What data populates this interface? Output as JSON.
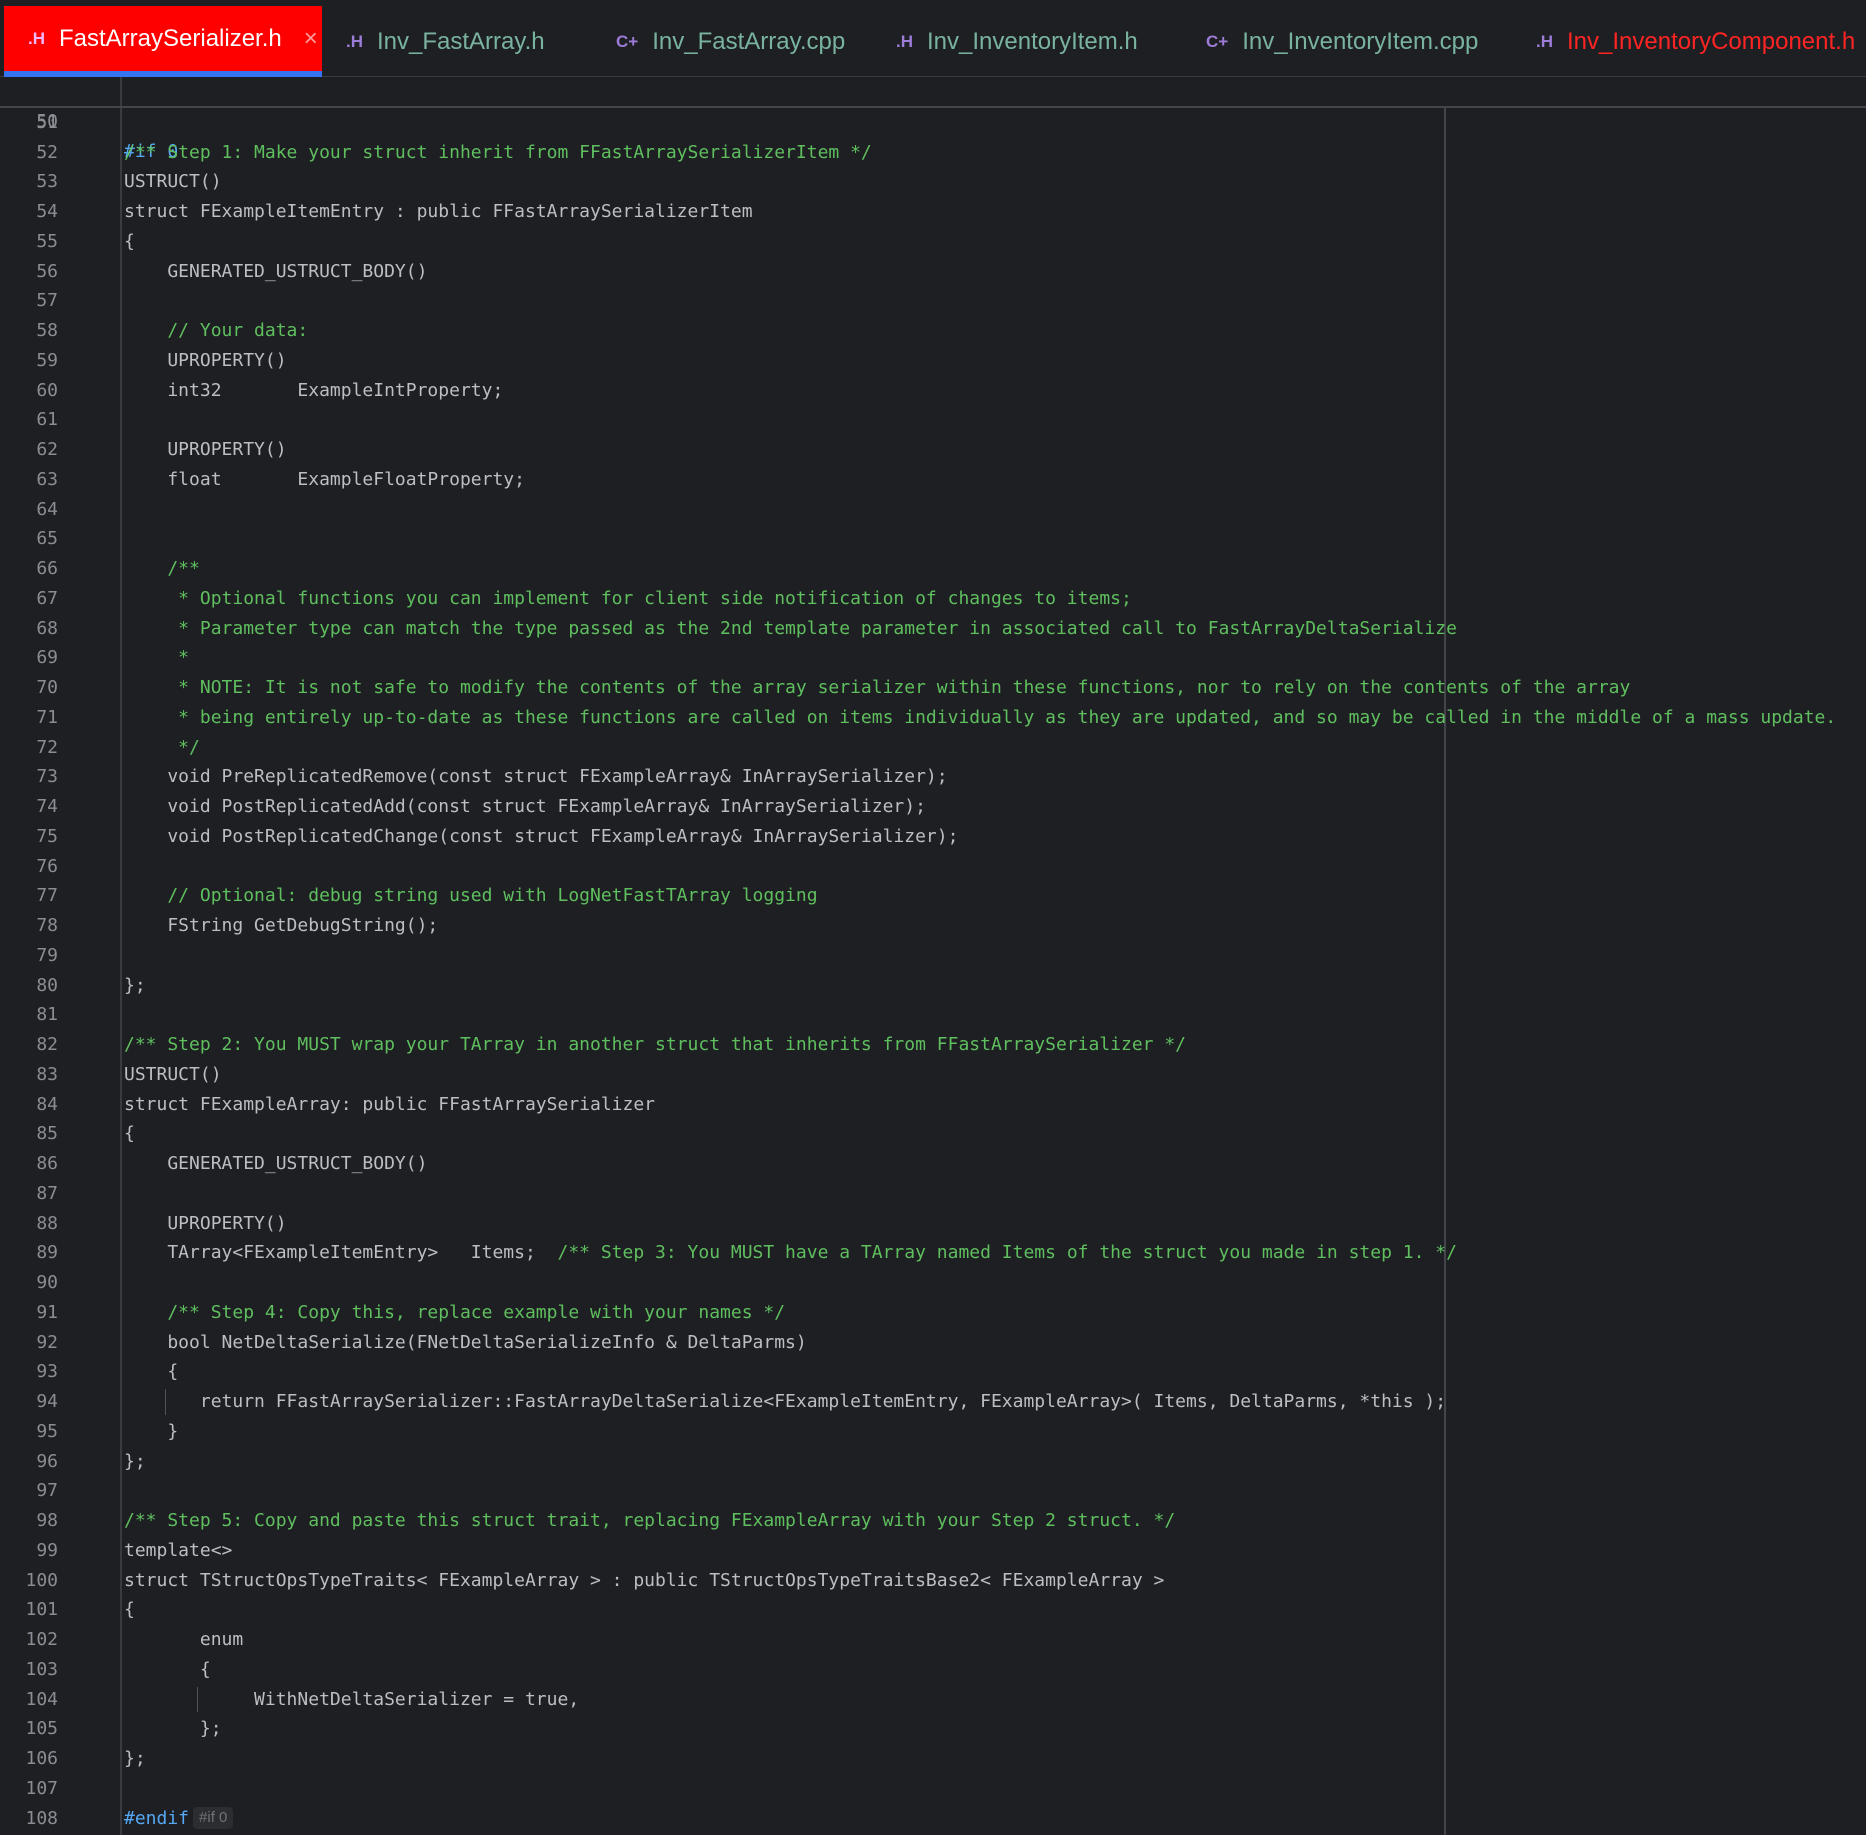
{
  "tabs": [
    {
      "label": "FastArraySerializer.h",
      "icon": "header-file-icon",
      "active": true
    },
    {
      "label": "Inv_FastArray.h",
      "icon": "header-file-icon"
    },
    {
      "label": "Inv_FastArray.cpp",
      "icon": "cpp-file-icon"
    },
    {
      "label": "Inv_InventoryItem.h",
      "icon": "header-file-icon"
    },
    {
      "label": "Inv_InventoryItem.cpp",
      "icon": "cpp-file-icon"
    },
    {
      "label": "Inv_InventoryComponent.h",
      "icon": "header-file-icon"
    }
  ],
  "tab_icons": {
    "header": ".H",
    "cpp": "C+",
    "close": "×"
  },
  "colors": {
    "active_tab": "#fe0000",
    "tab_text": "#79b3a0",
    "modified_tab_text": "#ff2424",
    "comment": "#5fbf5f",
    "preprocessor": "#56a8f5",
    "code_text": "#bcbec4",
    "background": "#1e1f22"
  },
  "editor": {
    "sticky_line": {
      "num": "50",
      "text": "#if 0"
    },
    "lines": [
      {
        "num": "51",
        "text": ""
      },
      {
        "num": "52",
        "text": "/** Step 1: Make your struct inherit from FFastArraySerializerItem */",
        "kind": "comment"
      },
      {
        "num": "53",
        "text": "USTRUCT()"
      },
      {
        "num": "54",
        "text": "struct FExampleItemEntry : public FFastArraySerializerItem"
      },
      {
        "num": "55",
        "text": "{"
      },
      {
        "num": "56",
        "text": "    GENERATED_USTRUCT_BODY()"
      },
      {
        "num": "57",
        "text": ""
      },
      {
        "num": "58",
        "text": "    // Your data:",
        "kind": "comment"
      },
      {
        "num": "59",
        "text": "    UPROPERTY()"
      },
      {
        "num": "60",
        "text": "    int32       ExampleIntProperty;"
      },
      {
        "num": "61",
        "text": ""
      },
      {
        "num": "62",
        "text": "    UPROPERTY()"
      },
      {
        "num": "63",
        "text": "    float       ExampleFloatProperty;"
      },
      {
        "num": "64",
        "text": ""
      },
      {
        "num": "65",
        "text": ""
      },
      {
        "num": "66",
        "text": "    /**",
        "kind": "comment"
      },
      {
        "num": "67",
        "text": "     * Optional functions you can implement for client side notification of changes to items;",
        "kind": "comment"
      },
      {
        "num": "68",
        "text": "     * Parameter type can match the type passed as the 2nd template parameter in associated call to FastArrayDeltaSerialize",
        "kind": "comment"
      },
      {
        "num": "69",
        "text": "     *",
        "kind": "comment"
      },
      {
        "num": "70",
        "text": "     * NOTE: It is not safe to modify the contents of the array serializer within these functions, nor to rely on the contents of the array",
        "kind": "comment"
      },
      {
        "num": "71",
        "text": "     * being entirely up-to-date as these functions are called on items individually as they are updated, and so may be called in the middle of a mass update.",
        "kind": "comment"
      },
      {
        "num": "72",
        "text": "     */",
        "kind": "comment"
      },
      {
        "num": "73",
        "text": "    void PreReplicatedRemove(const struct FExampleArray& InArraySerializer);"
      },
      {
        "num": "74",
        "text": "    void PostReplicatedAdd(const struct FExampleArray& InArraySerializer);"
      },
      {
        "num": "75",
        "text": "    void PostReplicatedChange(const struct FExampleArray& InArraySerializer);"
      },
      {
        "num": "76",
        "text": ""
      },
      {
        "num": "77",
        "text": "    // Optional: debug string used with LogNetFastTArray logging",
        "kind": "comment"
      },
      {
        "num": "78",
        "text": "    FString GetDebugString();"
      },
      {
        "num": "79",
        "text": ""
      },
      {
        "num": "80",
        "text": "};"
      },
      {
        "num": "81",
        "text": ""
      },
      {
        "num": "82",
        "text": "/** Step 2: You MUST wrap your TArray in another struct that inherits from FFastArraySerializer */",
        "kind": "comment"
      },
      {
        "num": "83",
        "text": "USTRUCT()"
      },
      {
        "num": "84",
        "text": "struct FExampleArray: public FFastArraySerializer"
      },
      {
        "num": "85",
        "text": "{"
      },
      {
        "num": "86",
        "text": "    GENERATED_USTRUCT_BODY()"
      },
      {
        "num": "87",
        "text": ""
      },
      {
        "num": "88",
        "text": "    UPROPERTY()"
      },
      {
        "num": "89",
        "text": "    TArray<FExampleItemEntry>   Items;",
        "trailing_comment": "  /** Step 3: You MUST have a TArray named Items of the struct you made in step 1. */"
      },
      {
        "num": "90",
        "text": ""
      },
      {
        "num": "91",
        "text": "    /** Step 4: Copy this, replace example with your names */",
        "kind": "comment"
      },
      {
        "num": "92",
        "text": "    bool NetDeltaSerialize(FNetDeltaSerializeInfo & DeltaParms)"
      },
      {
        "num": "93",
        "text": "    {"
      },
      {
        "num": "94",
        "text": "       return FFastArraySerializer::FastArrayDeltaSerialize<FExampleItemEntry, FExampleArray>( Items, DeltaParms, *this );"
      },
      {
        "num": "95",
        "text": "    }"
      },
      {
        "num": "96",
        "text": "};"
      },
      {
        "num": "97",
        "text": ""
      },
      {
        "num": "98",
        "text": "/** Step 5: Copy and paste this struct trait, replacing FExampleArray with your Step 2 struct. */",
        "kind": "comment"
      },
      {
        "num": "99",
        "text": "template<>"
      },
      {
        "num": "100",
        "text": "struct TStructOpsTypeTraits< FExampleArray > : public TStructOpsTypeTraitsBase2< FExampleArray >"
      },
      {
        "num": "101",
        "text": "{"
      },
      {
        "num": "102",
        "text": "       enum"
      },
      {
        "num": "103",
        "text": "       {"
      },
      {
        "num": "104",
        "text": "            WithNetDeltaSerializer = true,"
      },
      {
        "num": "105",
        "text": "       };"
      },
      {
        "num": "106",
        "text": "};"
      },
      {
        "num": "107",
        "text": ""
      },
      {
        "num": "108",
        "text": "#endif",
        "kind": "macro",
        "badge": "#if 0"
      }
    ]
  }
}
